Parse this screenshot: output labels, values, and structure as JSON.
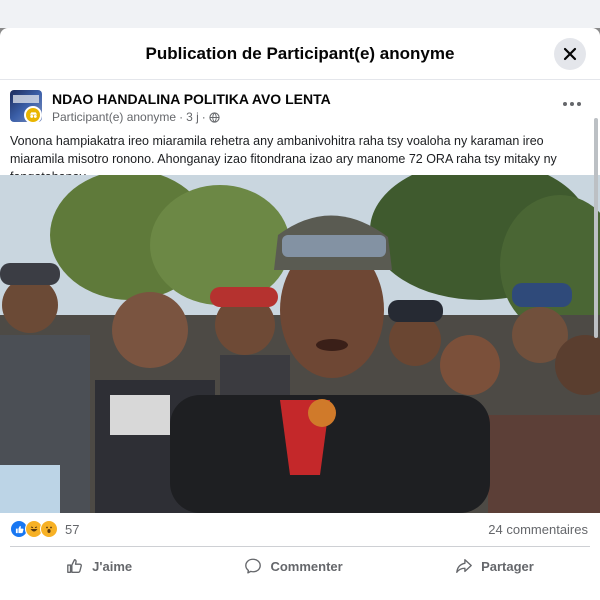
{
  "dialog": {
    "title": "Publication de Participant(e) anonyme"
  },
  "post": {
    "page_name": "NDAO HANDALINA POLITIKA AVO LENTA",
    "author": "Participant(e) anonyme",
    "time": "3 j",
    "privacy_icon": "globe-icon",
    "text": "Vonona hampiakatra ireo miaramila rehetra any ambanivohitra raha tsy voaloha ny karaman ireo miaramila misotro ronono. Ahonganay izao fitondrana izao ary manome 72 ORA raha tsy mitaky ny fangatahanay.",
    "photo_alt": "Crowd of men standing outdoors in front of trees"
  },
  "stats": {
    "reaction_icons": [
      "like-icon",
      "haha-icon",
      "wow-icon"
    ],
    "reaction_count": "57",
    "comments": "24 commentaires"
  },
  "actions": {
    "like": "J'aime",
    "comment": "Commenter",
    "share": "Partager"
  },
  "colors": {
    "accent": "#1877f2",
    "secondary_text": "#65676b",
    "divider": "#ced0d4"
  }
}
